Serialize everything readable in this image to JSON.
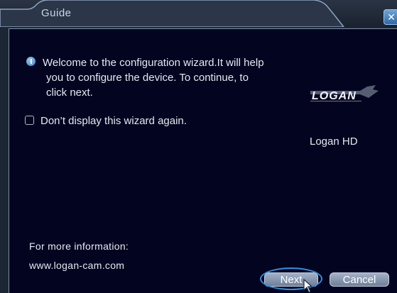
{
  "window": {
    "title": "Guide",
    "close_glyph": "✕"
  },
  "content": {
    "welcome_lines": [
      "Welcome to the configuration wizard.It will help",
      "you to configure the device. To continue, to",
      "click next."
    ],
    "checkbox_label": "Don’t display this wizard again.",
    "checkbox_checked": false,
    "logo_text": "LOGAN",
    "brand_name": "Logan HD",
    "more_info_label": "For more information:",
    "website": "www.logan-cam.com"
  },
  "buttons": {
    "next_label": "Next",
    "cancel_label": "Cancel"
  },
  "colors": {
    "panel_background": "#03041f",
    "accent_blue": "#2f8fe0"
  },
  "icons": {
    "info": "info-icon",
    "close": "close-icon",
    "cursor": "mouse-cursor-icon"
  }
}
